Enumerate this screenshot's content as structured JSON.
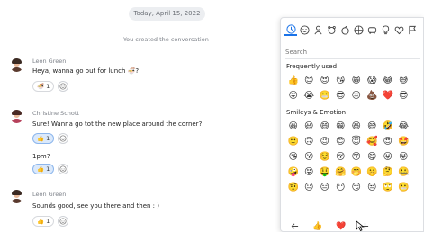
{
  "chat": {
    "date": "Today, April 15, 2022",
    "system_message": "You created the conversation",
    "messages": [
      {
        "sender": "Leon Green",
        "text": "Heya, wanna go out for lunch 🍜?",
        "reaction_emoji": "🍜",
        "reaction_count": "1"
      },
      {
        "sender": "Christine Schott",
        "text": "Sure! Wanna go tot the new place around the corner?",
        "reaction_emoji": "👍",
        "reaction_count": "1"
      },
      {
        "sender": "",
        "text": "1pm?",
        "reaction_emoji": "👍",
        "reaction_count": "1"
      },
      {
        "sender": "Leon Green",
        "text": "Sounds good, see you there and then : )",
        "reaction_emoji": "👍",
        "reaction_count": "1"
      }
    ]
  },
  "emoji_panel": {
    "categories": [
      "recent-icon",
      "smiley-icon",
      "person-icon",
      "animal-icon",
      "food-icon",
      "activity-icon",
      "travel-icon",
      "objects-icon",
      "symbols-icon",
      "flags-icon"
    ],
    "search_placeholder": "Search",
    "frequently_used_title": "Frequently used",
    "frequently_used": [
      "👍",
      "😊",
      "😍",
      "😘",
      "😁",
      "😱",
      "😂",
      "😅",
      "😛",
      "😭",
      "😬",
      "😎",
      "😒",
      "💩",
      "❤️",
      "😎"
    ],
    "smileys_title": "Smileys & Emotion",
    "smileys": [
      "😀",
      "😃",
      "😄",
      "😁",
      "😆",
      "😅",
      "🤣",
      "😂",
      "🙂",
      "🙃",
      "😉",
      "😊",
      "😇",
      "🥰",
      "😍",
      "🤩",
      "😘",
      "😗",
      "☺️",
      "😚",
      "😙",
      "😋",
      "😛",
      "😜",
      "🤪",
      "😝",
      "🤑",
      "🤗",
      "🤭",
      "🤫",
      "🤔",
      "🤐",
      "🤨",
      "😐",
      "😑",
      "😶",
      "😏",
      "😒",
      "🙄",
      "😬"
    ],
    "bottom_bar": {
      "back": "←",
      "thumbs": "👍",
      "heart": "❤️",
      "add": "+"
    }
  },
  "colors": {
    "accent": "#1a73e8",
    "reaction_active_bg": "#dbe9fb"
  }
}
